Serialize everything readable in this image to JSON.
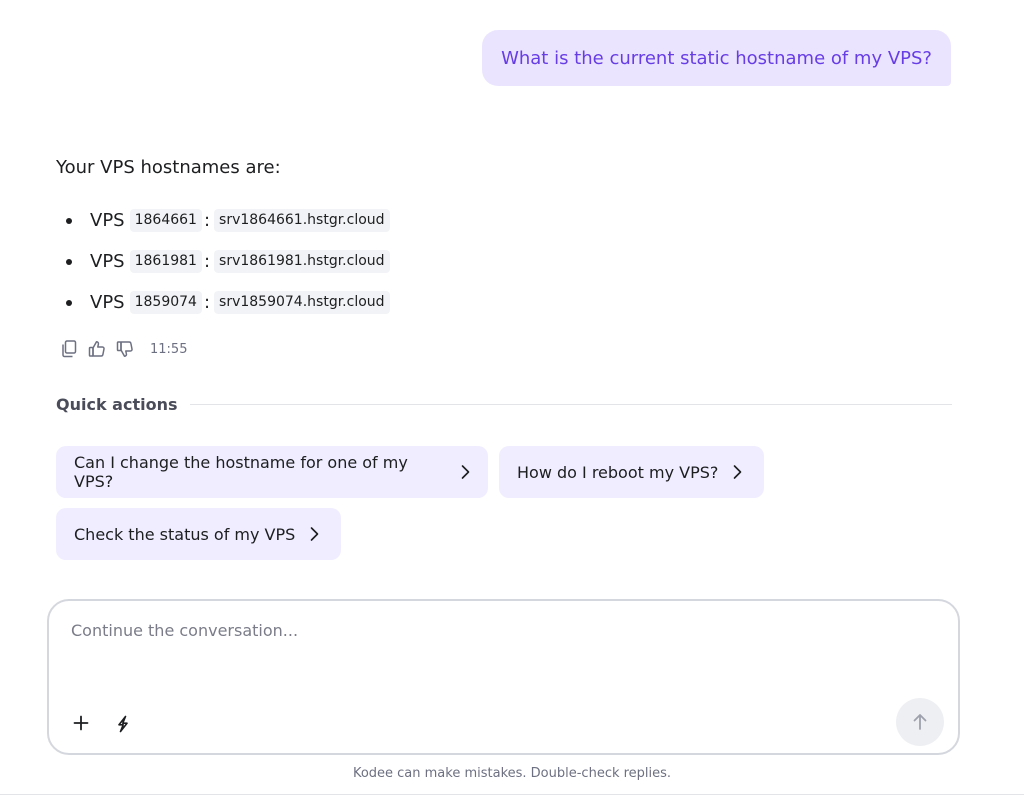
{
  "user_message": "What is the current static hostname of my VPS?",
  "assistant": {
    "intro": "Your VPS hostnames are:",
    "hosts": [
      {
        "prefix": "VPS",
        "id": "1864661",
        "hostname": "srv1864661.hstgr.cloud"
      },
      {
        "prefix": "VPS",
        "id": "1861981",
        "hostname": "srv1861981.hstgr.cloud"
      },
      {
        "prefix": "VPS",
        "id": "1859074",
        "hostname": "srv1859074.hstgr.cloud"
      }
    ],
    "colon": ":",
    "time": "11:55",
    "icons": [
      "copy-icon",
      "thumbs-up-icon",
      "thumbs-down-icon"
    ]
  },
  "quick_actions": {
    "title": "Quick actions",
    "items": [
      {
        "label": "Can I change the hostname for one of my VPS?"
      },
      {
        "label": "How do I reboot my VPS?"
      },
      {
        "label": "Check the status of my VPS"
      }
    ]
  },
  "composer": {
    "placeholder": "Continue the conversation...",
    "icons": [
      "plus-icon",
      "bolt-icon",
      "arrow-up-icon"
    ]
  },
  "disclaimer": "Kodee can make mistakes. Double-check replies.",
  "colors": {
    "accent": "#673de6",
    "user_bubble_bg": "#ebe4ff",
    "chip_bg": "#efedff",
    "tag_bg": "#f2f3f6"
  }
}
